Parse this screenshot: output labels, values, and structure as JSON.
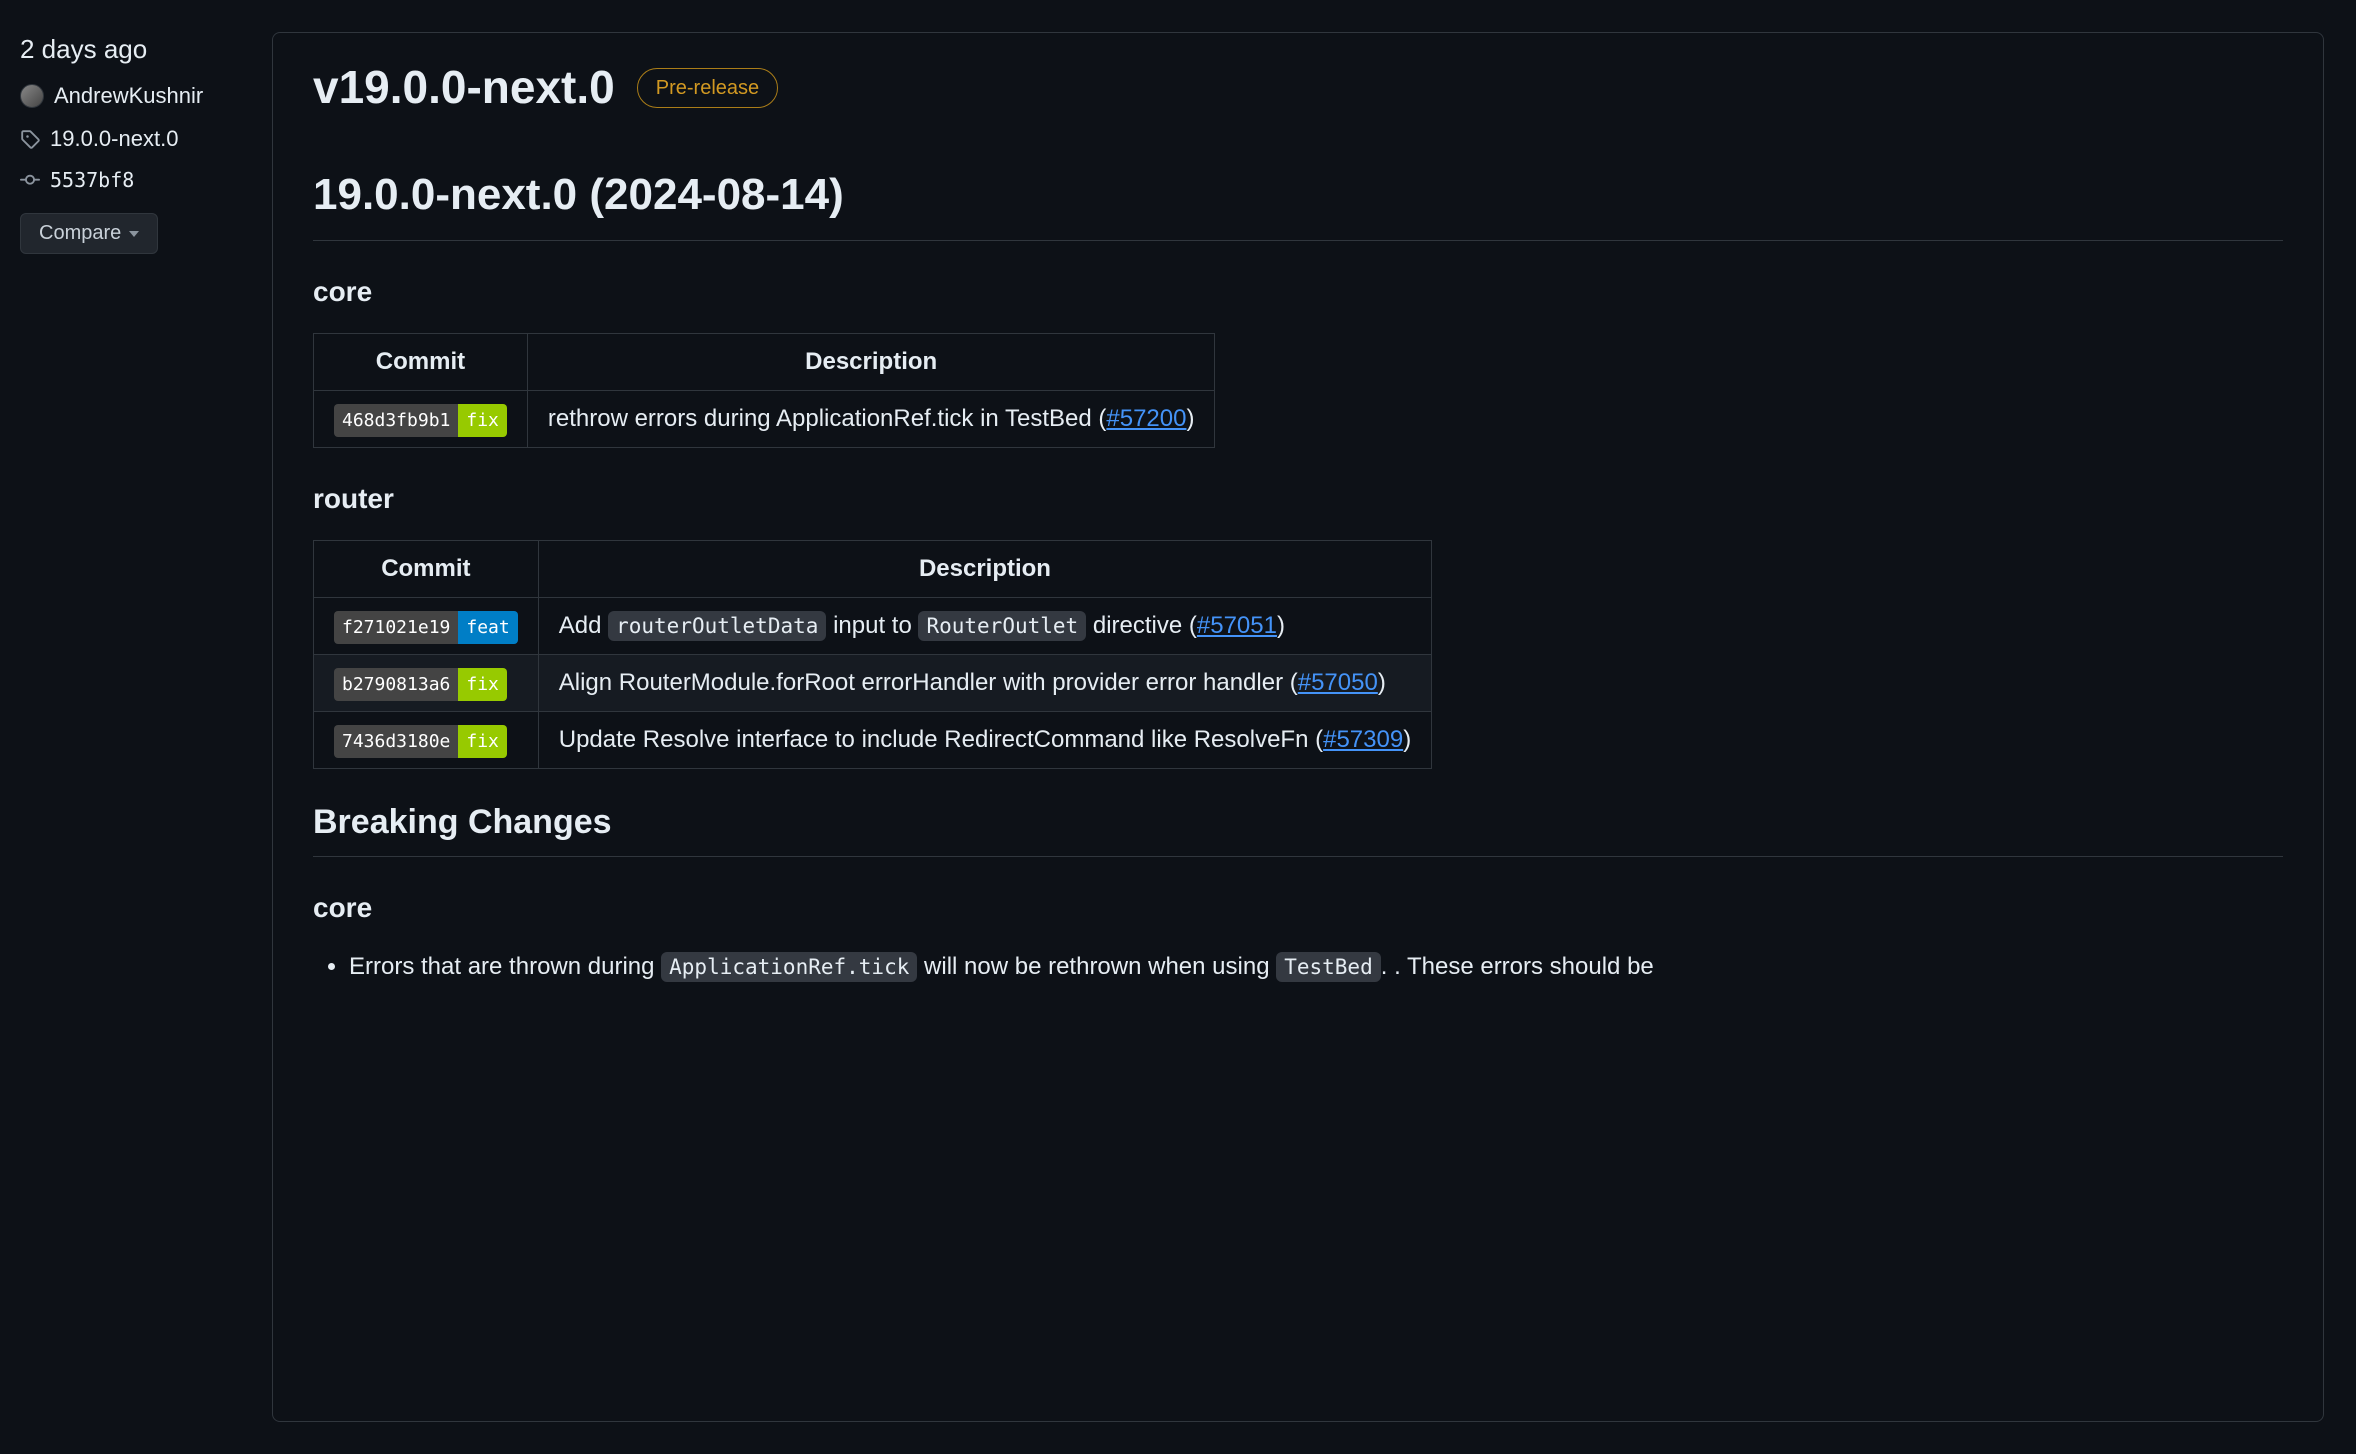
{
  "sidebar": {
    "time": "2 days ago",
    "author": "AndrewKushnir",
    "tag": "19.0.0-next.0",
    "commit": "5537bf8",
    "compare_label": "Compare"
  },
  "header": {
    "title": "v19.0.0-next.0",
    "badge": "Pre-release"
  },
  "body": {
    "heading": "19.0.0-next.0 (2024-08-14)",
    "sections": [
      {
        "title": "core",
        "table": {
          "headers": [
            "Commit",
            "Description"
          ],
          "rows": [
            {
              "hash": "468d3fb9b1",
              "type": "fix",
              "desc_parts": [
                "rethrow errors during ApplicationRef.tick in TestBed ("
              ],
              "issue": "#57200",
              "desc_after": ")"
            }
          ]
        }
      },
      {
        "title": "router",
        "table": {
          "headers": [
            "Commit",
            "Description"
          ],
          "rows": [
            {
              "hash": "f271021e19",
              "type": "feat",
              "desc_html": "Add <code>routerOutletData</code> input to <code>RouterOutlet</code> directive (",
              "issue": "#57051",
              "desc_after": ")"
            },
            {
              "hash": "b2790813a6",
              "type": "fix",
              "desc_parts": [
                "Align RouterModule.forRoot errorHandler with provider error handler ("
              ],
              "issue": "#57050",
              "desc_after": ")"
            },
            {
              "hash": "7436d3180e",
              "type": "fix",
              "desc_parts": [
                "Update Resolve interface to include RedirectCommand like ResolveFn ("
              ],
              "issue": "#57309",
              "desc_after": ")"
            }
          ]
        }
      }
    ],
    "breaking_changes_title": "Breaking Changes",
    "breaking_core_title": "core",
    "breaking_items": [
      {
        "text_before": "Errors that are thrown during ",
        "code1": "ApplicationRef.tick",
        "text_mid": " will now be rethrown when using ",
        "code2": "TestBed",
        "text_after": ". These errors should be"
      }
    ]
  }
}
